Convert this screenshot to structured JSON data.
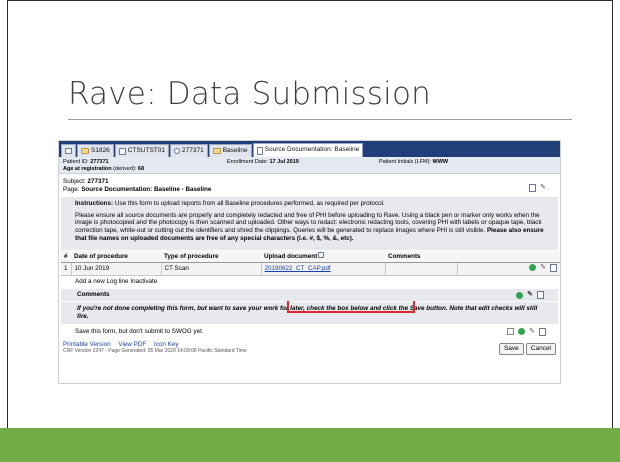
{
  "slide": {
    "title": "Rave: Data Submission",
    "colors": {
      "accent_bar": "#70ad47",
      "rave_nav": "#1f3e7a",
      "highlight_box": "#e0262f"
    }
  },
  "rave": {
    "tabs": [
      {
        "icon": "home-icon",
        "label": ""
      },
      {
        "icon": "folder-icon",
        "label": "S1826"
      },
      {
        "icon": "site-icon",
        "label": "CTSUTST01"
      },
      {
        "icon": "person-icon",
        "label": "277371"
      },
      {
        "icon": "folder-icon",
        "label": "Baseline"
      },
      {
        "icon": "document-icon",
        "label": "Source Documentation: Baseline"
      }
    ],
    "patient_bar": {
      "patient_id_label": "Patient ID:",
      "patient_id": "277371",
      "age_label": "Age at registration",
      "age_derived": "(derived):",
      "age": "68",
      "enrollment_label": "Enrollment Date:",
      "enrollment": "17 Jul 2019",
      "initials_label": "Patient Initials (LFM):",
      "initials": "WWW"
    },
    "subject": {
      "subject_label": "Subject:",
      "subject_value": "277371",
      "page_label": "Page:",
      "page_value": "Source Documentation: Baseline - Baseline"
    },
    "instructions": {
      "label": "Instructions:",
      "text1": "Use this form to upload reports from all Baseline procedures performed, as required per protocol.",
      "text2": "Please ensure all source documents are properly and completely redacted and free of PHI before uploading to Rave. Using a black pen or marker only works when the image is photocopied and the photocopy is then scanned and uploaded. Other ways to redact: electronic redacting tools, covering PHI with labels or opaque tape, black correction tape, white-out or cutting out the identifiers and shred the clippings. Queries will be generated to replace images where PHI is still visible.",
      "text3": "Please also ensure that file names on uploaded documents are free of any special characters (i.e. #, $, %, &, etc)."
    },
    "table": {
      "headers": [
        "#",
        "Date of procedure",
        "Type of procedure",
        "Upload document",
        "Comments",
        ""
      ],
      "rows": [
        {
          "num": "1",
          "date": "10 Jun 2019",
          "type": "CT Scan",
          "upload": "20190622_CT_CAP.pdf",
          "comments": ""
        }
      ]
    },
    "add_line": "Add a new Log line",
    "inactivate": "Inactivate",
    "comments_label": "Comments",
    "warning": "If you're not done completing this form, but want to save your work for later, check the box below and click the Save button. Note that edit checks will still fire.",
    "save_later": "Save this form, but don't submit to SWOG yet.",
    "footer": {
      "printable": "Printable Version",
      "view_pdf": "View PDF",
      "icon_key": "Icon Key",
      "version": "CRF Version 2247 - Page Generated: 05 Mar 2020 14:09:08 Pacific Standard Time",
      "save": "Save",
      "cancel": "Cancel"
    }
  }
}
